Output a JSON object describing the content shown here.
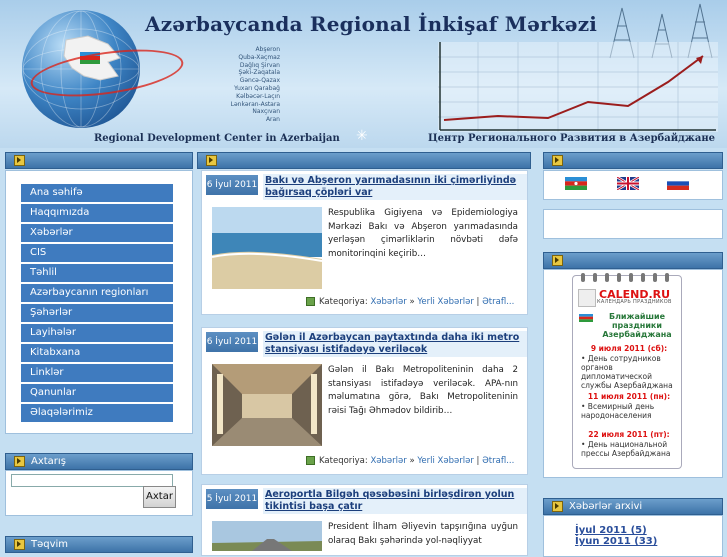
{
  "header": {
    "title": "Azərbaycanda Regional İnkişaf Mərkəzi",
    "subtitle_en": "Regional Development Center in Azerbaijan",
    "subtitle_ru": "Центр  Регионального  Развития в  Азербайджане",
    "regions": [
      "Abşeron",
      "Quba-Xaçmaz",
      "Dağlıq Şirvan",
      "Şəki-Zaqatala",
      "Gəncə-Qazax",
      "Yuxarı Qarabağ",
      "Kəlbəcər-Laçın",
      "Lənkəran-Astara",
      "Naxçıvan",
      "Aran"
    ]
  },
  "nav": {
    "items": [
      "Ana səhifə",
      "Haqqımızda",
      "Xəbərlər",
      "CIS",
      "Təhlil",
      "Azərbaycanın regionları",
      "Şəhərlər",
      "Layihələr",
      "Kitabxana",
      "Linklər",
      "Qanunlar",
      "Əlaqələrimiz"
    ]
  },
  "search": {
    "heading": "Axtarış",
    "button": "Axtar"
  },
  "calendar_left": {
    "heading": "Təqvim"
  },
  "articles": [
    {
      "date": "6 İyul 2011",
      "title": "Bakı və Abşeron yarımadasının iki çimərliyində bağırsaq çöpləri var",
      "text": "Respublika Gigiyena və Epidemiologiya Mərkəzi Bakı və Abşeron yarımadasında yerləşən çimərliklərin növbəti dəfə monitorinqini keçirib…",
      "cat_label": "Kateqoriya:",
      "cat1": "Xəbərlər",
      "sep": "»",
      "cat2": "Yerli Xəbərlər",
      "sep2": "|",
      "more": "Ətrafl..."
    },
    {
      "date": "6 İyul 2011",
      "title": "Gələn il Azərbaycan paytaxtında daha iki metro stansiyası istifadəyə veriləcək",
      "text": "Gələn il Bakı Metropoliteninin daha 2 stansiyası istifadəyə veriləcək. APA-nın məlumatına görə, Bakı Metropoliteninin rəisi Tağı Əhmədov bildirib…",
      "cat_label": "Kateqoriya:",
      "cat1": "Xəbərlər",
      "sep": "»",
      "cat2": "Yerli Xəbərlər",
      "sep2": "|",
      "more": "Ətrafl..."
    },
    {
      "date": "5 İyul 2011",
      "title": "Aeroportla Bilgəh qəsəbəsini birləşdirən yolun tikintisi başa çatır",
      "text": "President İlham Əliyevin tapşırığına uyğun olaraq Bakı şəhərində yol-nəqliyyat"
    }
  ],
  "calendar_widget": {
    "logo": "CALEND.RU",
    "sub": "КАЛЕНДАРЬ  ПРАЗДНИКОВ",
    "holidays_title": "Ближайшие праздники Азербайджана",
    "events": [
      {
        "date": "9 июля 2011 (сб):",
        "text": "• День сотрудников органов дипломатической службы Азербайджана"
      },
      {
        "date": "11 июля 2011 (пн):",
        "text": "• Всемирный день народонаселения"
      },
      {
        "date": "22 июля 2011 (пт):",
        "text": "• День национальной прессы Азербайджана"
      }
    ]
  },
  "archive": {
    "heading": "Xəbərlər arxivi",
    "items": [
      "İyul 2011 (5)",
      "İyun 2011 (33)"
    ]
  },
  "colors": {
    "nav_bg": "#3f7bbf",
    "header_bar": "#3d73a8",
    "page_bg": "#c5dff2"
  }
}
